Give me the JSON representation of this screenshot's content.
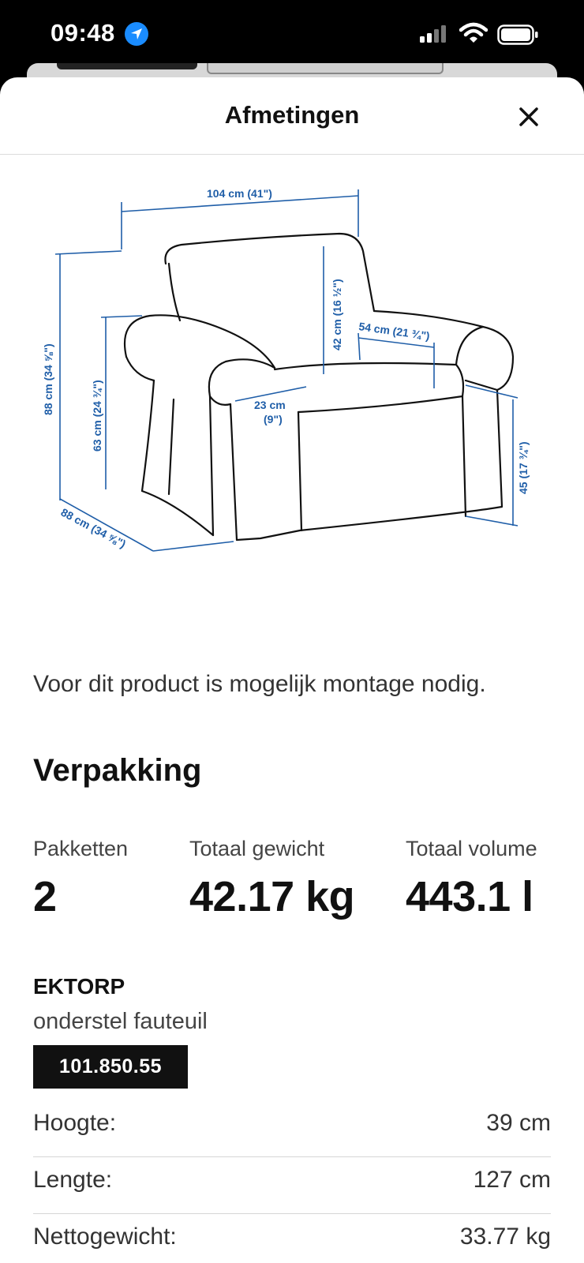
{
  "status_bar": {
    "time": "09:48",
    "icons": [
      "location-icon",
      "signal-icon",
      "wifi-icon",
      "battery-icon"
    ]
  },
  "modal": {
    "title": "Afmetingen",
    "close_icon": "close-icon"
  },
  "diagram": {
    "width_label": "104 cm (41\")",
    "height_label": "88 cm (34 ⅝\")",
    "arm_height_label": "63 cm (24 ¾\")",
    "back_height_label": "42 cm (16 ½\")",
    "seat_width_label": "54 cm (21 ¾\")",
    "arm_width_label_1": "23 cm",
    "arm_width_label_2": "(9\")",
    "seat_height_label": "45 (17 ¾\")",
    "depth_label": "88 cm (34 ⅝\")",
    "line_color": "#1f5ea8"
  },
  "assembly_note": "Voor dit product is mogelijk montage nodig.",
  "packaging": {
    "title": "Verpakking",
    "packages_label": "Pakketten",
    "packages_value": "2",
    "weight_label": "Totaal gewicht",
    "weight_value": "42.17 kg",
    "volume_label": "Totaal volume",
    "volume_value": "443.1 l"
  },
  "product": {
    "name": "EKTORP",
    "description": "onderstel fauteuil",
    "article_number": "101.850.55",
    "specs": [
      {
        "label": "Hoogte:",
        "value": "39 cm"
      },
      {
        "label": "Lengte:",
        "value": "127 cm"
      },
      {
        "label": "Nettogewicht:",
        "value": "33.77 kg"
      }
    ]
  }
}
